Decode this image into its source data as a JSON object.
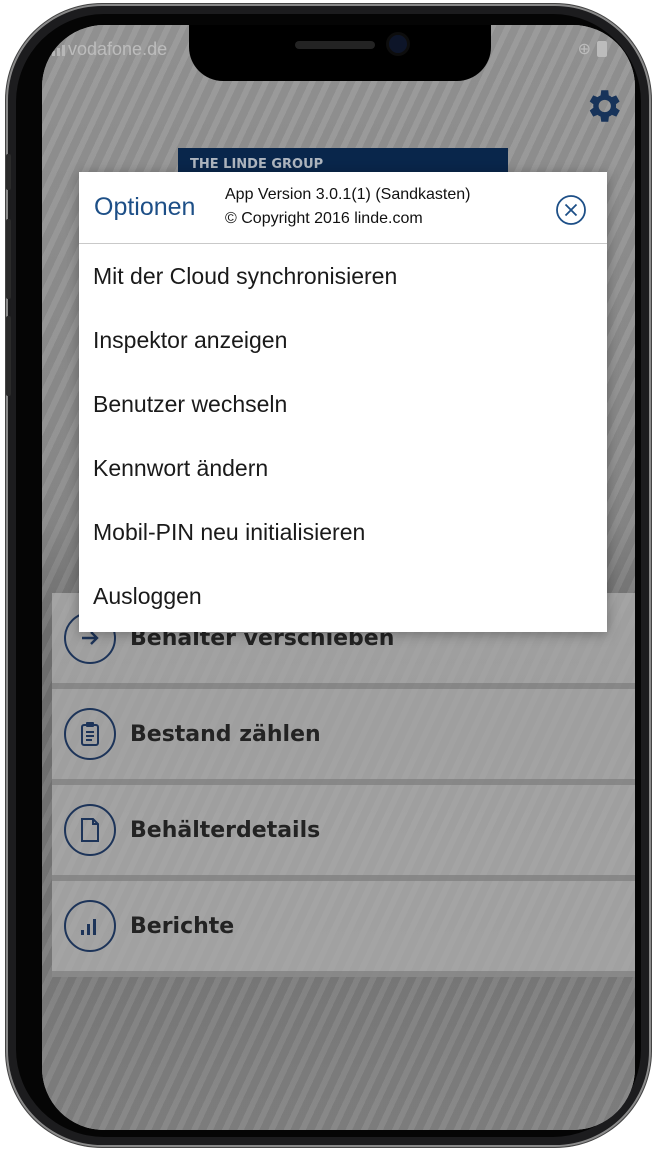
{
  "status_bar": {
    "carrier": "vodafone.de"
  },
  "brand_banner": "THE LINDE GROUP",
  "main_menu": [
    {
      "label": "Behälter verschieben",
      "icon": "arrow-right-icon"
    },
    {
      "label": "Bestand zählen",
      "icon": "clipboard-icon"
    },
    {
      "label": "Behälterdetails",
      "icon": "document-icon"
    },
    {
      "label": "Berichte",
      "icon": "bar-chart-icon"
    }
  ],
  "options_dialog": {
    "title": "Optionen",
    "version": "App Version 3.0.1(1) (Sandkasten)",
    "copyright": "© Copyright 2016 linde.com",
    "items": [
      "Mit der Cloud synchronisieren",
      "Inspektor anzeigen",
      "Benutzer wechseln",
      "Kennwort ändern",
      "Mobil-PIN neu initialisieren",
      "Ausloggen"
    ]
  },
  "colors": {
    "accent": "#1d4f87",
    "brand_bar": "#0c2f5c"
  }
}
